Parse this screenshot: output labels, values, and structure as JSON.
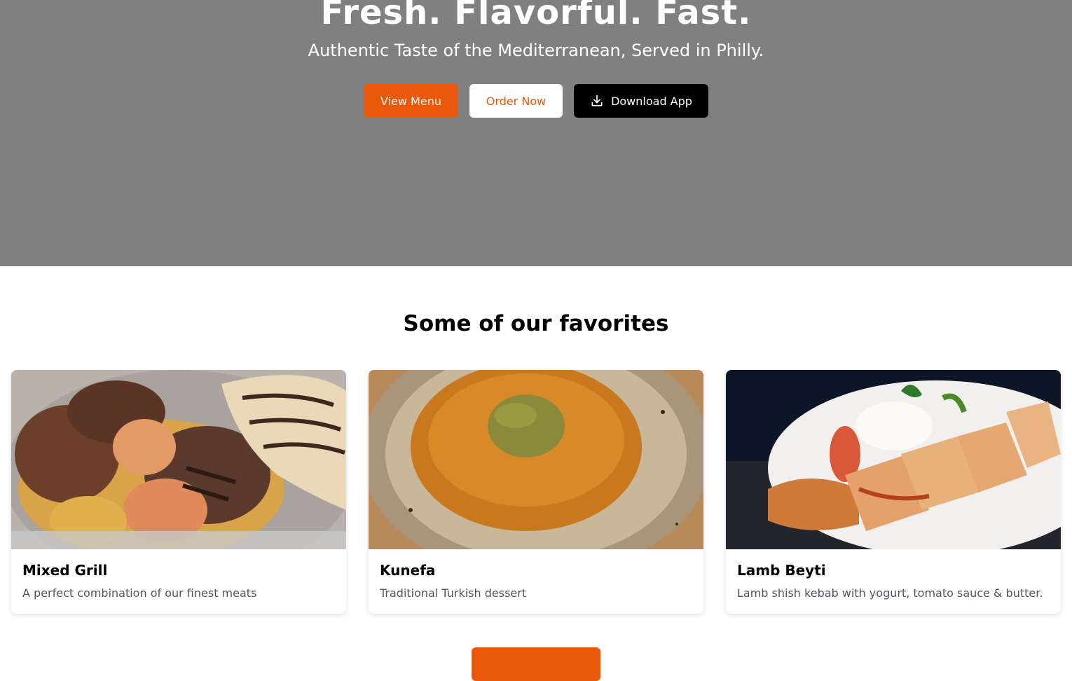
{
  "hero": {
    "title": "Fresh. Flavorful. Fast.",
    "subtitle": "Authentic Taste of the Mediterranean, Served in Philly.",
    "buttons": {
      "view_menu": "View Menu",
      "order_now": "Order Now",
      "download_app": "Download App",
      "download_icon": "download-icon"
    }
  },
  "favorites": {
    "heading": "Some of our favorites",
    "items": [
      {
        "name": "Mixed Grill",
        "description": "A perfect combination of our finest meats"
      },
      {
        "name": "Kunefa",
        "description": "Traditional Turkish dessert"
      },
      {
        "name": "Lamb Beyti",
        "description": "Lamb shish kebab with yogurt, tomato sauce & butter."
      }
    ]
  },
  "colors": {
    "accent": "#ea580c",
    "hero_overlay": "#808080",
    "app_button": "#000000",
    "muted_text": "#4b5563"
  }
}
